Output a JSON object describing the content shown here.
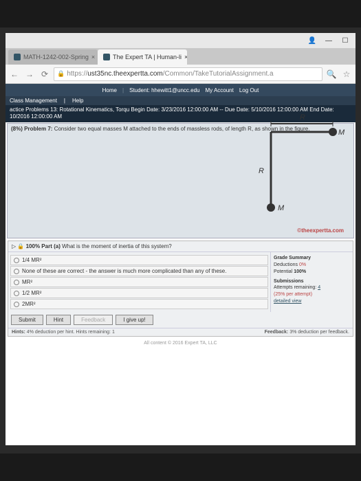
{
  "window": {
    "minimize": "—",
    "maximize": "☐",
    "close": ""
  },
  "tabs": [
    {
      "label": "MATH-1242-002-Spring",
      "active": false
    },
    {
      "label": "The Expert TA | Human-li",
      "active": true
    }
  ],
  "url": {
    "proto": "https://",
    "host": "ust35nc.theexpertta.com",
    "path": "/Common/TakeTutorialAssignment.a"
  },
  "topnav": {
    "home": "Home",
    "student": "Student: hhewitt1@uncc.edu",
    "account": "My Account",
    "logout": "Log Out"
  },
  "bluebar": {
    "cm": "Class Management",
    "help": "Help"
  },
  "assign": {
    "title": "actice Problems 13: Rotational Kinematics, Torqu",
    "begin_lbl": "Begin Date:",
    "begin": "3/23/2016 12:00:00 AM",
    "due_lbl": "-- Due Date:",
    "due": "5/10/2016 12:00:00 AM",
    "end_lbl": "End Date:",
    "end": "10/2016 12:00:00 AM"
  },
  "problem": {
    "num": "(8%) Problem 7:",
    "text": "Consider two equal masses M attached to the ends of massless rods, of length R, as shown in the figure."
  },
  "diagram": {
    "R": "R",
    "M": "M"
  },
  "brand": "©theexpertta.com",
  "part": {
    "pct": "100%",
    "lbl": "Part (a)",
    "q": "What is the moment of inertia of this system?"
  },
  "choices": [
    "1/4 MR²",
    "None of these are correct - the answer is much more complicated than any of these.",
    "MR²",
    "1/2 MR²",
    "2MR²"
  ],
  "summary": {
    "hdr": "Grade Summary",
    "ded_lbl": "Deductions",
    "ded": "0%",
    "pot_lbl": "Potential",
    "pot": "100%",
    "sub_hdr": "Submissions",
    "att_lbl": "Attempts remaining:",
    "att": "4",
    "per": "(25% per attempt)",
    "detail": "detailed view"
  },
  "buttons": {
    "submit": "Submit",
    "hint": "Hint",
    "feed": "Feedback",
    "give": "I give up!"
  },
  "hints": {
    "left_a": "Hints:",
    "left_b": "4%",
    "left_c": "deduction per hint. Hints remaining:",
    "left_d": "1",
    "right_a": "Feedback:",
    "right_b": "3%",
    "right_c": "deduction per feedback."
  },
  "footer": "All content © 2016 Expert TA, LLC"
}
